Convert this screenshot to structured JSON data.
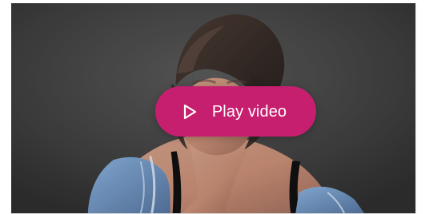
{
  "video": {
    "play_label": "Play video",
    "button_icon": "play-icon",
    "colors": {
      "button": "#c71f6f",
      "background": "#393939",
      "text": "#ffffff"
    }
  }
}
